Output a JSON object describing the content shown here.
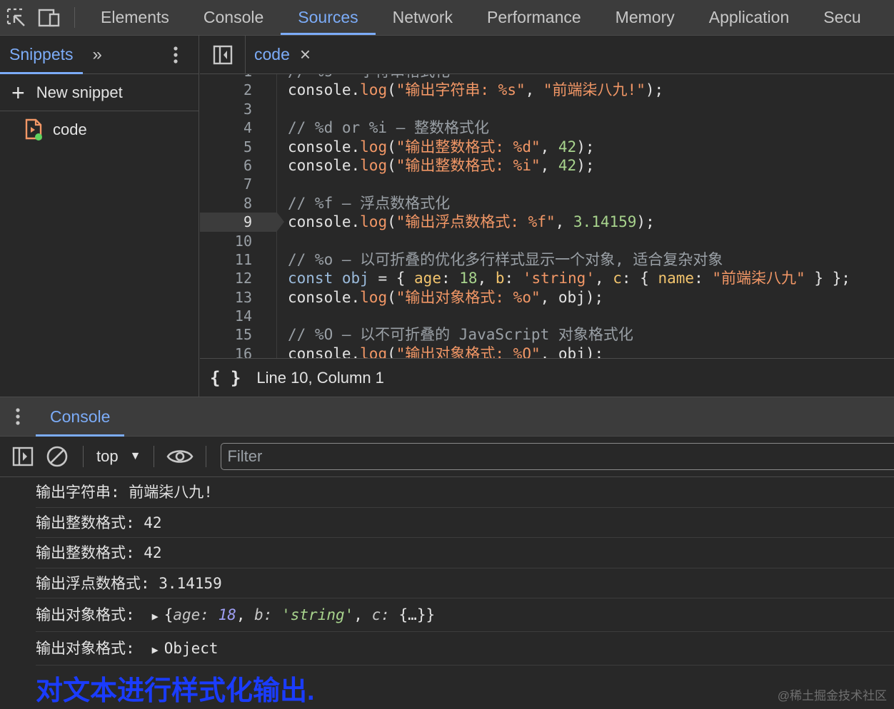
{
  "toolbar": {
    "tabs": [
      "Elements",
      "Console",
      "Sources",
      "Network",
      "Performance",
      "Memory",
      "Application",
      "Secu"
    ],
    "active_tab": "Sources",
    "accent_color": "#7cacf8"
  },
  "navigator": {
    "tab_label": "Snippets",
    "more_label": "»",
    "new_snippet_label": "New snippet",
    "file_name": "code"
  },
  "editor": {
    "tab_label": "code",
    "close_label": "×",
    "line_numbers": [
      "1",
      "2",
      "3",
      "4",
      "5",
      "6",
      "7",
      "8",
      "9",
      "10",
      "11",
      "12",
      "13",
      "14",
      "15",
      "16"
    ],
    "current_line": "9",
    "status": "Line 10, Column 1",
    "format_label": "{ }",
    "code_text": {
      "l1_comment": "// %s – 字符串格式化",
      "l2_str": "\"输出字符串: %s\"",
      "l2_arg": "\"前端柒八九!\"",
      "l4_comment": "// %d or %i – 整数格式化",
      "l5_str": "\"输出整数格式: %d\"",
      "l6_str": "\"输出整数格式: %i\"",
      "num_42": "42",
      "l8_comment": "// %f – 浮点数格式化",
      "l9_str": "\"输出浮点数格式: %f\"",
      "l9_num": "3.14159",
      "l11_comment": "// %o – 以可折叠的优化多行样式显示一个对象, 适合复杂对象",
      "l12_kw": "const",
      "l12_var": "obj",
      "l12_num": "18",
      "l12_str": "'string'",
      "l12_name": "\"前端柒八九\"",
      "l13_str": "\"输出对象格式: %o\"",
      "l15_comment": "// %O – 以不可折叠的 JavaScript 对象格式化",
      "l16_str": "\"输出对象格式: %O\""
    }
  },
  "drawer": {
    "tab_label": "Console",
    "context": "top",
    "filter_placeholder": "Filter"
  },
  "console_messages": {
    "m1": "输出字符串: 前端柒八九!",
    "m2": "输出整数格式: 42",
    "m3": "输出整数格式: 42",
    "m4": "输出浮点数格式: 3.14159",
    "m5_prefix": "输出对象格式:",
    "m5_obj": {
      "age_key": "age",
      "age_val": "18",
      "b_key": "b",
      "b_val": "'string'",
      "c_key": "c",
      "c_val": "{…}"
    },
    "m6_prefix": "输出对象格式:",
    "m6_obj": "Object",
    "styled_text": "对文本进行样式化输出."
  },
  "watermark": "@稀土掘金技术社区"
}
